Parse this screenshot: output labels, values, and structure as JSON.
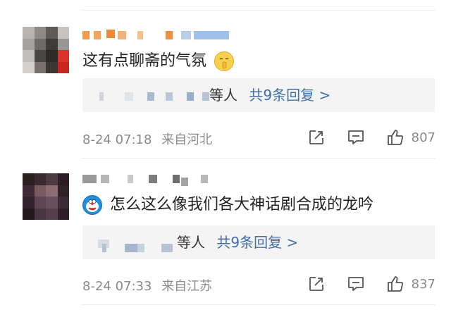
{
  "comments": [
    {
      "content": "这有点聊斋的气氛",
      "emoji_icon": "shush-face-emoji-icon",
      "reply_suffix": "等人",
      "reply_more": "共9条回复 >",
      "time": "8-24 07:18",
      "location": "来自河北",
      "like_count": "807"
    },
    {
      "content": "怎么这么像我们各大神话剧合成的龙吟",
      "emoji_icon": "doraemon-emoji-icon",
      "reply_suffix": "等人",
      "reply_more": "共9条回复 >",
      "time": "8-24 07:33",
      "location": "来自江苏",
      "like_count": "837"
    }
  ],
  "colors": {
    "link": "#3f6ea8",
    "meta": "#8a8a8a",
    "reply_bg": "#f4f4f4"
  }
}
